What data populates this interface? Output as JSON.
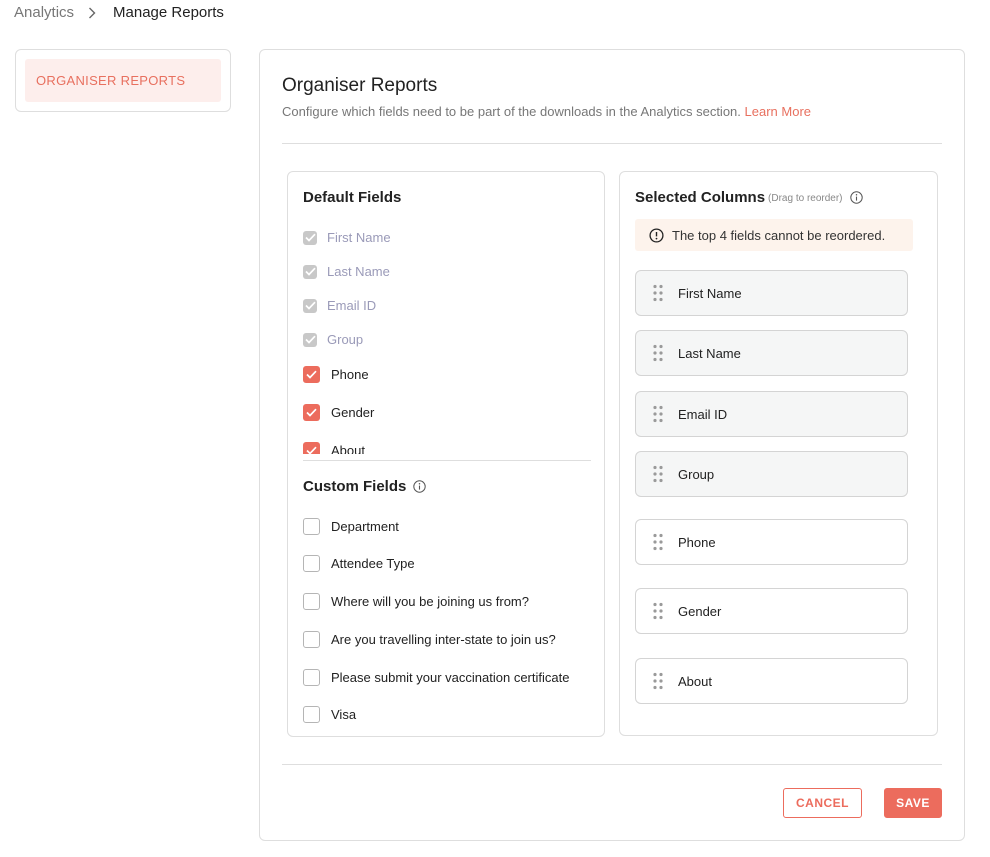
{
  "breadcrumb": {
    "root": "Analytics",
    "current": "Manage Reports"
  },
  "sidebar": {
    "items": [
      {
        "label": "ORGANISER REPORTS"
      }
    ]
  },
  "page": {
    "title": "Organiser Reports",
    "description": "Configure which fields need to be part of the downloads in the Analytics section.",
    "learn_more": "Learn More"
  },
  "default_fields": {
    "heading": "Default Fields",
    "items": [
      {
        "label": "First Name",
        "state": "locked"
      },
      {
        "label": "Last Name",
        "state": "locked"
      },
      {
        "label": "Email ID",
        "state": "locked"
      },
      {
        "label": "Group",
        "state": "locked"
      },
      {
        "label": "Phone",
        "state": "checked"
      },
      {
        "label": "Gender",
        "state": "checked"
      },
      {
        "label": "About",
        "state": "checked"
      }
    ]
  },
  "custom_fields": {
    "heading": "Custom Fields",
    "items": [
      {
        "label": "Department",
        "state": "unchecked"
      },
      {
        "label": "Attendee Type",
        "state": "unchecked"
      },
      {
        "label": "Where will you be joining us from?",
        "state": "unchecked"
      },
      {
        "label": "Are you travelling inter-state to join us?",
        "state": "unchecked"
      },
      {
        "label": "Please submit your vaccination certificate",
        "state": "unchecked"
      },
      {
        "label": "Visa",
        "state": "unchecked"
      }
    ]
  },
  "selected_columns": {
    "heading": "Selected Columns",
    "hint": "(Drag to reorder)",
    "notice": "The top 4 fields cannot be reordered.",
    "items": [
      {
        "label": "First Name",
        "locked": true
      },
      {
        "label": "Last Name",
        "locked": true
      },
      {
        "label": "Email ID",
        "locked": true
      },
      {
        "label": "Group",
        "locked": true
      },
      {
        "label": "Phone",
        "locked": false
      },
      {
        "label": "Gender",
        "locked": false
      },
      {
        "label": "About",
        "locked": false
      }
    ]
  },
  "actions": {
    "cancel": "CANCEL",
    "save": "SAVE"
  },
  "colors": {
    "accent": "#ec6c5d",
    "accent_soft": "#fdeeec",
    "notice_bg": "#fdf3ec",
    "locked_check": "#c8c8c8"
  }
}
